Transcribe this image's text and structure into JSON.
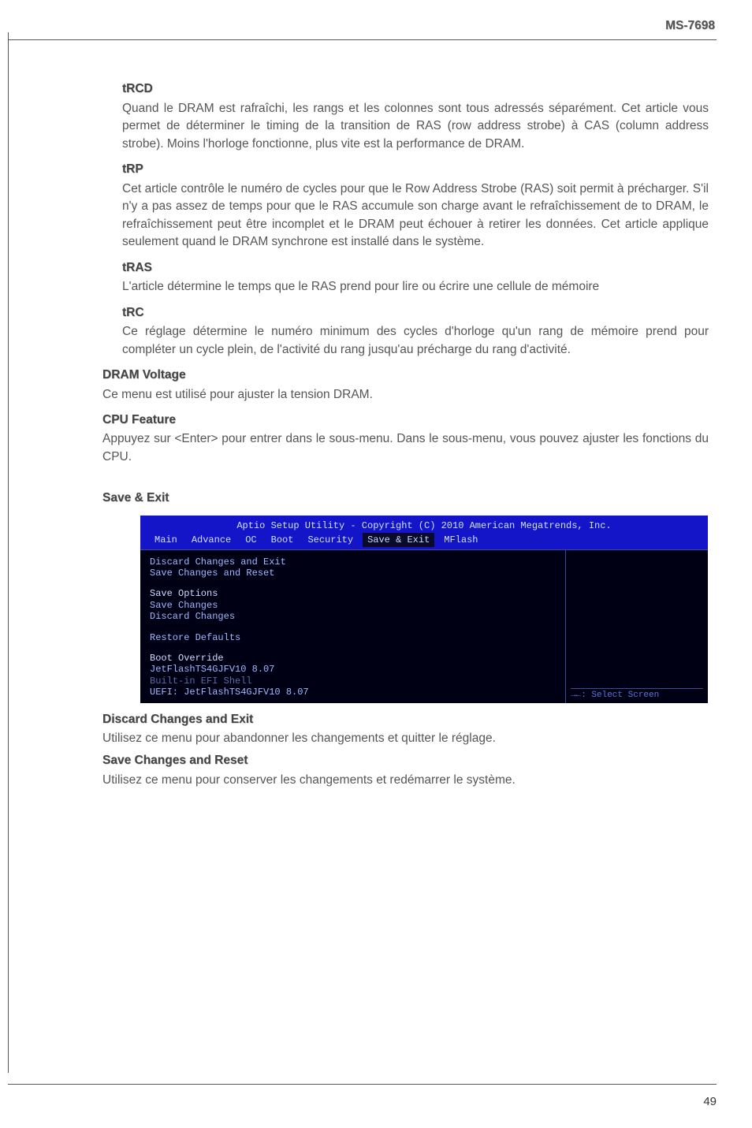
{
  "header": {
    "model": "MS-7698"
  },
  "s_trcd": {
    "title": "tRCD",
    "body": "Quand le DRAM est rafraîchi, les rangs et les colonnes sont tous adressés séparément. Cet article vous permet de déterminer le timing de la transition de RAS (row address strobe) à CAS (column address strobe). Moins l'horloge fonctionne, plus vite est la performance de DRAM."
  },
  "s_trp": {
    "title": "tRP",
    "body": "Cet article contrôle le numéro de cycles pour que le Row Address Strobe (RAS) soit permit à précharger. S'il n'y a pas assez de temps pour que le RAS accumule son charge avant le refraîchissement de  to DRAM, le refraîchissement peut être incomplet et le DRAM peut échouer à retirer les données. Cet article applique seulement quand le DRAM synchrone est installé dans le système."
  },
  "s_tras": {
    "title": "tRAS",
    "body": "L'article détermine le temps que le RAS prend pour lire ou écrire une cellule de mémoire"
  },
  "s_trc": {
    "title": "tRC",
    "body": "Ce réglage détermine le numéro minimum des cycles d'horloge qu'un rang de mémoire prend pour compléter un cycle plein, de l'activité du rang jusqu'au précharge du rang d'activité."
  },
  "s_dram": {
    "title": "DRAM Voltage",
    "body": "Ce menu est utilisé pour ajuster la tension DRAM."
  },
  "s_cpu": {
    "title": "CPU Feature",
    "body": "Appuyez sur <Enter> pour entrer dans le sous-menu. Dans le sous-menu, vous pouvez ajuster les fonctions du CPU."
  },
  "save_exit": {
    "title": "Save & Exit"
  },
  "bios": {
    "title": "Aptio Setup Utility - Copyright (C) 2010 American Megatrends, Inc.",
    "tabs": {
      "t1": "Main",
      "t2": "Advance",
      "t3": "OC",
      "t4": "Boot",
      "t5": "Security",
      "t6": "Save & Exit",
      "t7": "MFlash"
    },
    "l1": "Discard Changes and Exit",
    "l2": "Save Changes and Reset",
    "l3": "Save Options",
    "l4": "Save Changes",
    "l5": "Discard Changes",
    "l6": "Restore Defaults",
    "l7": "Boot Override",
    "l8": "JetFlashTS4GJFV10 8.07",
    "l9": "Built-in EFI Shell",
    "l10": "UEFI: JetFlashTS4GJFV10 8.07",
    "nav": "→←: Select Screen"
  },
  "s_discard": {
    "title": "Discard Changes and Exit",
    "body": "Utilisez ce menu pour abandonner les changements et quitter le réglage."
  },
  "s_savereset": {
    "title": "Save Changes and Reset",
    "body": "Utilisez ce menu pour conserver les changements et redémarrer le système."
  },
  "page_num": "49"
}
